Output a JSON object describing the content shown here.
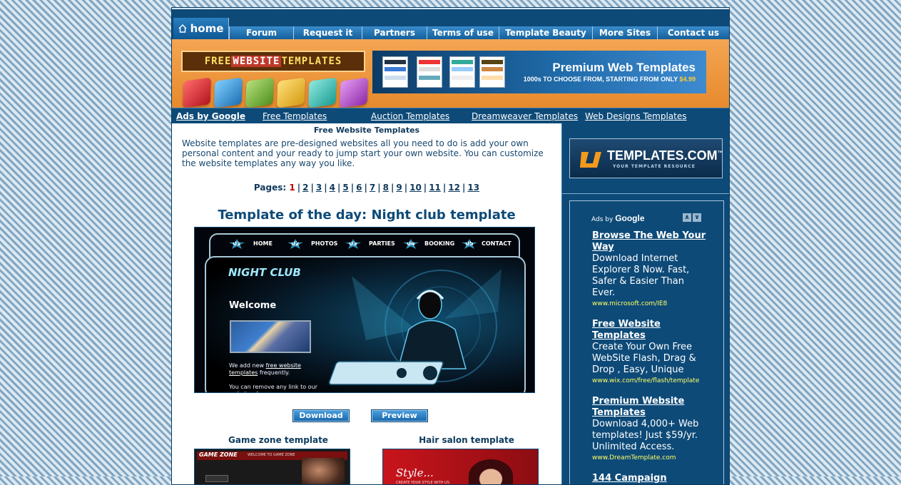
{
  "nav": {
    "home": "home",
    "items": [
      "Forum",
      "Request it",
      "Partners",
      "Terms of use",
      "Template Beauty",
      "More Sites",
      "Contact us"
    ]
  },
  "banner": {
    "logo_left": "FREE",
    "logo_mid": "WEBSITE",
    "logo_right": "TEMPLATES",
    "premium_title": "Premium Web Templates",
    "premium_sub": "1000s TO CHOOSE FROM, STARTING FROM ONLY",
    "premium_price": "$4.99"
  },
  "adsbar": {
    "ads_by": "Ads by Google",
    "links": [
      "Free Templates",
      "Auction Templates",
      "Dreamweaver Templates",
      "Web Designs Templates"
    ]
  },
  "main": {
    "heading": "Free Website Templates",
    "intro": "Website templates are pre-designed websites all you need to do is add your own personal content and your ready to jump start your own website. You can customize the website templates any way you like.",
    "pages_label": "Pages:",
    "pages": [
      "1",
      "2",
      "3",
      "4",
      "5",
      "6",
      "7",
      "8",
      "9",
      "10",
      "11",
      "12",
      "13"
    ],
    "current_page": "1",
    "tod_title": "Template of the day: Night club template",
    "download": "Download",
    "preview": "Preview",
    "game_zone": "Game zone template",
    "hair_salon": "Hair salon template"
  },
  "nightclub": {
    "tabs": [
      {
        "num": "01",
        "label": "HOME"
      },
      {
        "num": "02",
        "label": "PHOTOS"
      },
      {
        "num": "03",
        "label": "PARTIES"
      },
      {
        "num": "04",
        "label": "BOOKING"
      },
      {
        "num": "05",
        "label": "CONTACT"
      }
    ],
    "title": "NIGHT CLUB",
    "welcome": "Welcome",
    "text1": "We add new",
    "text1_link": "free website templates",
    "text1_end": "frequently.",
    "text2": "You can remove any link to our websites from"
  },
  "thumbs": {
    "game_logo": "GAME ZONE",
    "game_bar": "WELCOME TO GAME ZONE",
    "hair_logo": "Style...",
    "hair_sub": "CREATE YOUR STYLE WITH US"
  },
  "sidebar": {
    "tpl_name": "TEMPLATES.COM",
    "tpl_tm": "™",
    "tpl_tag": "YOUR TEMPLATE RESOURCE",
    "ads_by": "Ads by",
    "google": "Google",
    "ads": [
      {
        "title": "Browse The Web Your Way",
        "desc": "Download Internet Explorer 8 Now. Fast, Safer & Easier Than Ever.",
        "url": "www.microsoft.com/IE8"
      },
      {
        "title": "Free Website Templates",
        "desc": "Create Your Own Free WebSite Flash, Drag & Drop , Easy, Unique",
        "url": "www.wix.com/free/flash/template"
      },
      {
        "title": "Premium Website Templates",
        "desc": "Download 4,000+ Web templates! Just $59/yr. Unlimited Access.",
        "url": "www.DreamTemplate.com"
      },
      {
        "title": "144 Campaign",
        "desc": "",
        "url": ""
      }
    ]
  }
}
